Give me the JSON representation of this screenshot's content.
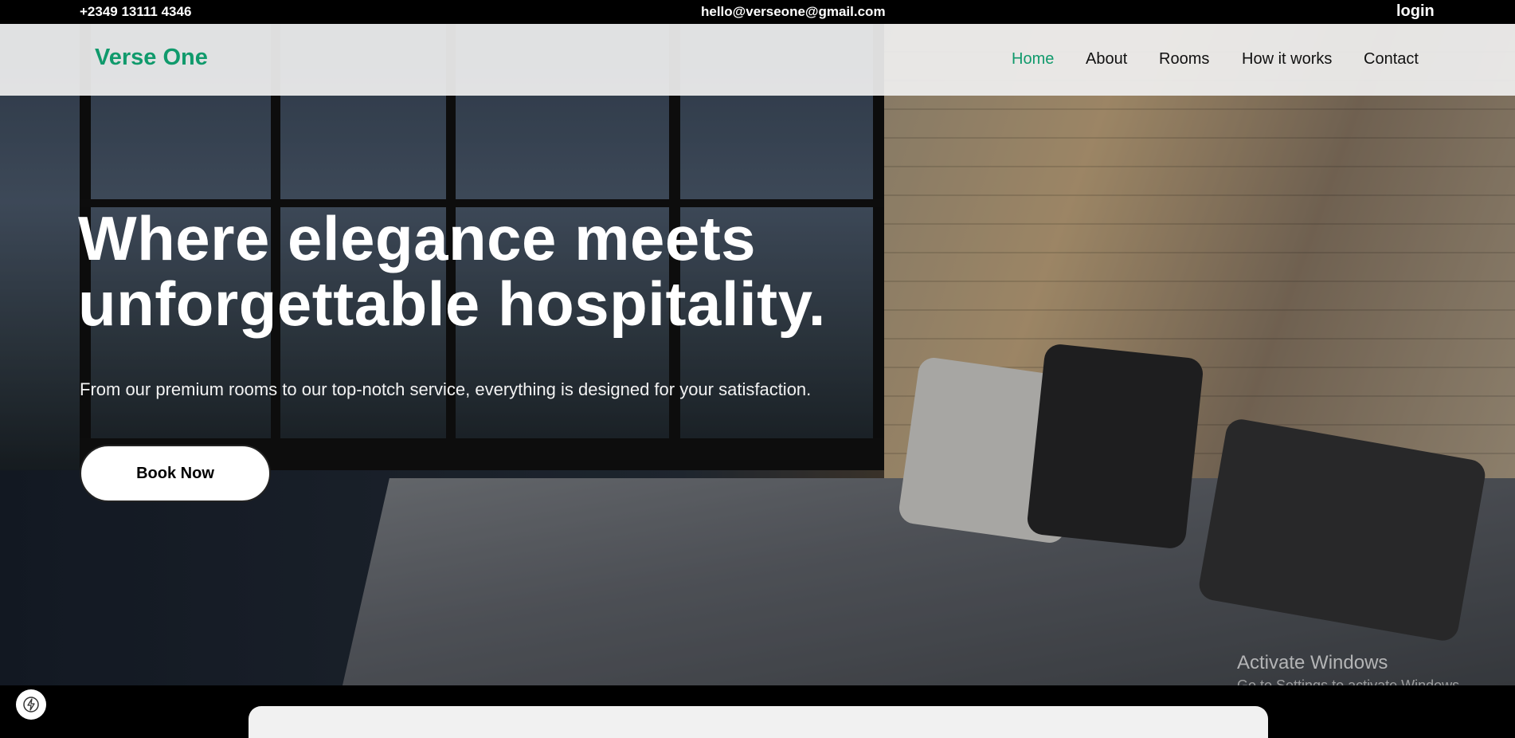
{
  "topbar": {
    "phone": "+2349 13111 4346",
    "email": "hello@verseone@gmail.com",
    "login": "login"
  },
  "nav": {
    "brand": "Verse One",
    "links": [
      "Home",
      "About",
      "Rooms",
      "How it works",
      "Contact"
    ],
    "active": "Home"
  },
  "hero": {
    "headline_line1": "Where elegance meets",
    "headline_line2": "unforgettable hospitality.",
    "subtext": "From our premium rooms to our top-notch service, everything is designed for your satisfaction.",
    "cta": "Book Now"
  },
  "watermark": {
    "title": "Activate Windows",
    "subtitle": "Go to Settings to activate Windows."
  },
  "colors": {
    "brand": "#109a6c",
    "topbar_bg": "#000000",
    "nav_bg": "#f0f0f0"
  },
  "icons": {
    "badge": "lightning-bolt-icon"
  }
}
